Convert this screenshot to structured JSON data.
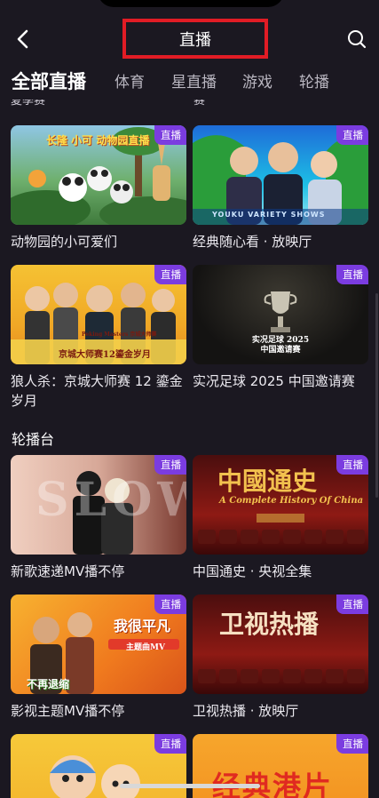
{
  "header": {
    "title": "直播"
  },
  "tabs": [
    {
      "label": "全部直播"
    },
    {
      "label": "体育"
    },
    {
      "label": "星直播"
    },
    {
      "label": "游戏"
    },
    {
      "label": "轮播"
    }
  ],
  "clipped": {
    "left": "夏季赛",
    "right": "赛"
  },
  "badge_label": "直播",
  "section1": {
    "cards": [
      {
        "title": "动物园的小可爱们",
        "art_text": "长隆 小可 动物园直播"
      },
      {
        "title": "经典随心看 · 放映厅",
        "art_text": "YOUKU VARIETY SHOWS"
      },
      {
        "title": "狼人杀：京城大师赛 12 鎏金岁月",
        "art_text": "京城大师赛12鎏金岁月",
        "art_logo": "Peking Masters 京城大师赛"
      },
      {
        "title": "实况足球 2025 中国邀请赛",
        "art_text": "实况足球 2025中国邀请赛"
      }
    ]
  },
  "section2": {
    "title": "轮播台",
    "cards": [
      {
        "title": "新歌速递MV播不停",
        "art_text": "SLOW"
      },
      {
        "title": "中国通史 · 央视全集",
        "art_text": "中國通史",
        "art_sub": "A Complete History Of China"
      },
      {
        "title": "影视主题MV播不停",
        "art_text": "我很平凡",
        "art_sub": "主题曲MV",
        "art_extra": "不再退缩"
      },
      {
        "title": "卫视热播 · 放映厅",
        "art_text": "卫视热播"
      },
      {
        "title": "",
        "art_text": ""
      },
      {
        "title": "",
        "art_text": "经典港片"
      }
    ]
  },
  "colors": {
    "accent": "#7b3ce0",
    "highlight_box": "#e11c25",
    "background": "#1b1821"
  }
}
